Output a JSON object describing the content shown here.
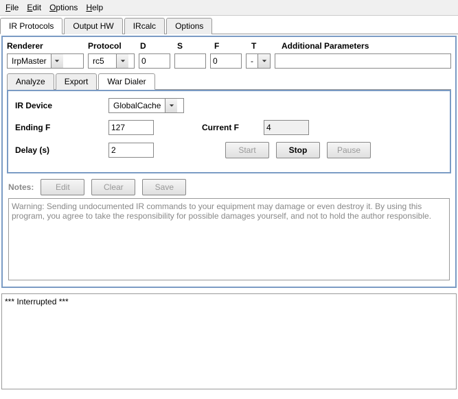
{
  "menu": {
    "file": "File",
    "edit": "Edit",
    "options": "Options",
    "help": "Help"
  },
  "main_tabs": {
    "ir_protocols": "IR Protocols",
    "output_hw": "Output HW",
    "ircalc": "IRcalc",
    "options": "Options"
  },
  "headers": {
    "renderer": "Renderer",
    "protocol": "Protocol",
    "d": "D",
    "s": "S",
    "f": "F",
    "t": "T",
    "additional": "Additional Parameters"
  },
  "values": {
    "renderer": "IrpMaster",
    "protocol": "rc5",
    "d": "0",
    "s": "",
    "f": "0",
    "t": "-",
    "additional": ""
  },
  "sub_tabs": {
    "analyze": "Analyze",
    "export": "Export",
    "war_dialer": "War Dialer"
  },
  "war": {
    "ir_device_label": "IR Device",
    "ir_device_value": "GlobalCache",
    "ending_f_label": "Ending F",
    "ending_f_value": "127",
    "current_f_label": "Current F",
    "current_f_value": "4",
    "delay_label": "Delay (s)",
    "delay_value": "2",
    "start": "Start",
    "stop": "Stop",
    "pause": "Pause"
  },
  "notes": {
    "label": "Notes:",
    "edit": "Edit",
    "clear": "Clear",
    "save": "Save",
    "text": "Warning: Sending undocumented IR commands to your equipment may damage or even destroy it. By using this program, you agree to take the responsibility for possible damages yourself, and not to hold the author responsible."
  },
  "log": "*** Interrupted ***"
}
